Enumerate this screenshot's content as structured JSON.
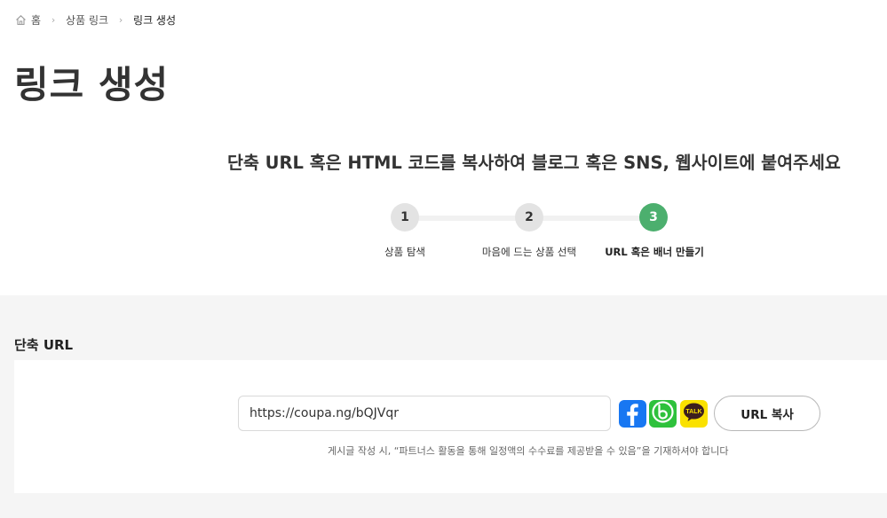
{
  "breadcrumb": {
    "home": "홈",
    "products_link": "상품 링크",
    "current": "링크 생성"
  },
  "page": {
    "title": "링크 생성",
    "instruction": "단축 URL 혹은 HTML 코드를 복사하여 블로그 혹은 SNS, 웹사이트에 붙여주세요"
  },
  "steps": [
    {
      "number": "1",
      "label": "상품 탐색",
      "active": false
    },
    {
      "number": "2",
      "label": "마음에 드는 상품 선택",
      "active": false
    },
    {
      "number": "3",
      "label": "URL 혹은 배너 만들기",
      "active": true
    }
  ],
  "short_url": {
    "section_title": "단축 URL",
    "url_value": "https://coupa.ng/bQJVqr",
    "copy_label": "URL 복사",
    "notice": "게시글 작성 시, “파트너스 활동을 통해 일정액의 수수료를 제공받을 수 있음”을 기재하셔야 합니다",
    "share": {
      "facebook_icon": "facebook-icon",
      "band_icon": "band-icon",
      "kakao_icon": "kakaotalk-icon",
      "kakao_text": "TALK"
    }
  },
  "colors": {
    "accent_green": "#4caf6e",
    "facebook": "#1877f2",
    "band": "#2ec13c",
    "kakao": "#fae100",
    "background_gray": "#f5f5f5"
  }
}
